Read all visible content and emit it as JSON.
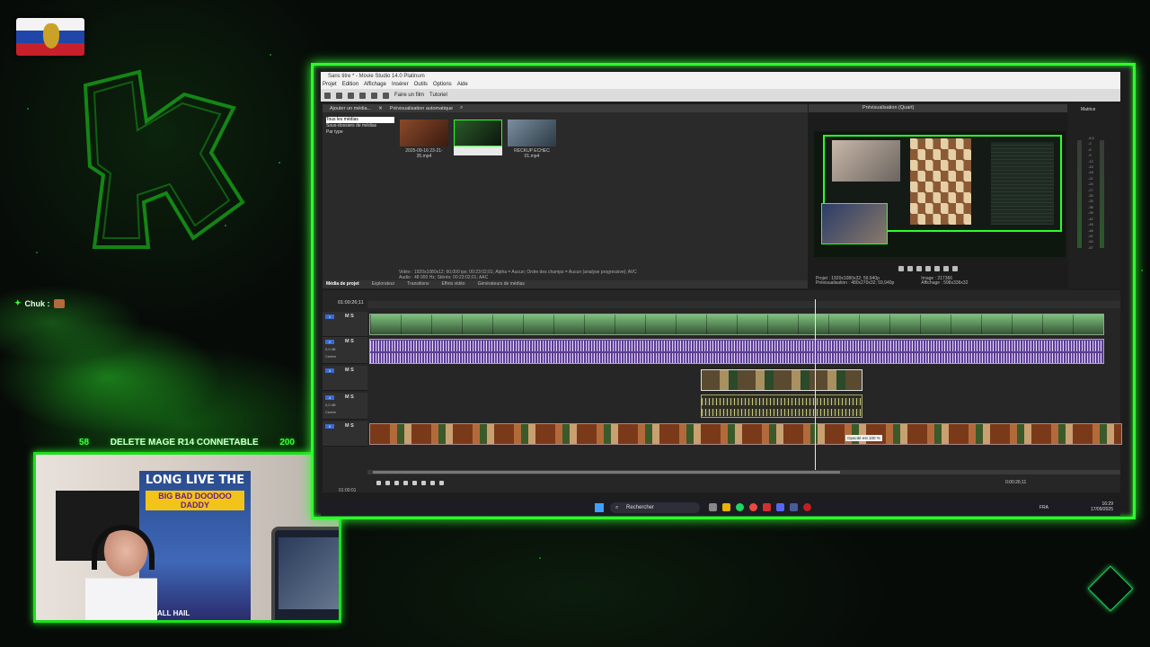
{
  "stream": {
    "chat_user": "Chuk :",
    "goal_left": "58",
    "goal_text": "DELETE MAGE R14 CONNETABLE",
    "goal_right": "200",
    "webcam_poster_title": "LONG LIVE THE",
    "webcam_poster_sub": "BIG BAD DOODOO DADDY",
    "webcam_poster_foot": "ALL HAIL"
  },
  "window": {
    "title": "Sans titre * - Movie Studio 14.0 Platinum",
    "menu": [
      "Projet",
      "Edition",
      "Affichage",
      "Insérer",
      "Outils",
      "Options",
      "Aide"
    ],
    "toolbar": {
      "make_movie": "Faire un film",
      "tutorial": "Tutoriel"
    }
  },
  "media": {
    "add_label": "Ajouter un média...",
    "auto_preview": "Prévisualisation automatique",
    "tree": [
      "Tous les médias",
      "Sous-dossiers de médias",
      "Par type"
    ],
    "thumbs": [
      {
        "label": "2025-09-16 23-21-35.mp4",
        "color": "#8a4a2a"
      },
      {
        "label": "",
        "color": "#1f3a1f"
      },
      {
        "label": "RECKUP ECHEC 01.mp4",
        "color": "#5a7080"
      }
    ],
    "info_line1": "Vidéo : 1920x1080x12; 60,000 ips; 00:23:02;01; Alpha = Aucun; Ordre des champs = Aucun (analyse progressive); AVC",
    "info_line2": "Audio : 48 000 Hz; Stéréo; 00:23:02;01; AAC",
    "tabs": [
      "Média de projet",
      "Explorateur",
      "Transitions",
      "Effets vidéo",
      "Générateurs de médias"
    ]
  },
  "preview": {
    "title": "Prévisualisation (Quart)",
    "project_label": "Projet :",
    "project_value": "1920x1080x32; 59,940p",
    "preview_label": "Prévisualisation :",
    "preview_value": "480x270x32; 59,940p",
    "frame_label": "Image :",
    "frame_value": "217366",
    "display_label": "Affichage :",
    "display_value": "598x336x32"
  },
  "mixer": {
    "label": "Matrice",
    "scale": [
      "-6,0",
      "-3",
      "-6",
      "-9",
      "-12",
      "-15",
      "-18",
      "-21",
      "-24",
      "-27",
      "-30",
      "-33",
      "-36",
      "-39",
      "-42",
      "-45",
      "-48",
      "-51",
      "-54",
      "-57"
    ]
  },
  "timeline": {
    "timecode": "01:00:26;11",
    "tracks": [
      {
        "n": "1",
        "ms": "M S"
      },
      {
        "n": "2",
        "ms": "M S",
        "gain": "0,0 dB",
        "pan": "Centre"
      },
      {
        "n": "3",
        "ms": "M S"
      },
      {
        "n": "4",
        "ms": "M S",
        "gain": "0,0 dB",
        "pan": "Centre"
      },
      {
        "n": "5",
        "ms": "M S"
      }
    ],
    "tooltip": "Opacité est 100 %",
    "end_time": "0:00:26;11",
    "bottom_time": "01:00:01"
  },
  "taskbar": {
    "search": "Rechercher",
    "lang": "FRA",
    "time": "16:29",
    "date": "17/09/2025"
  },
  "colors": {
    "accent": "#2cff2c"
  }
}
